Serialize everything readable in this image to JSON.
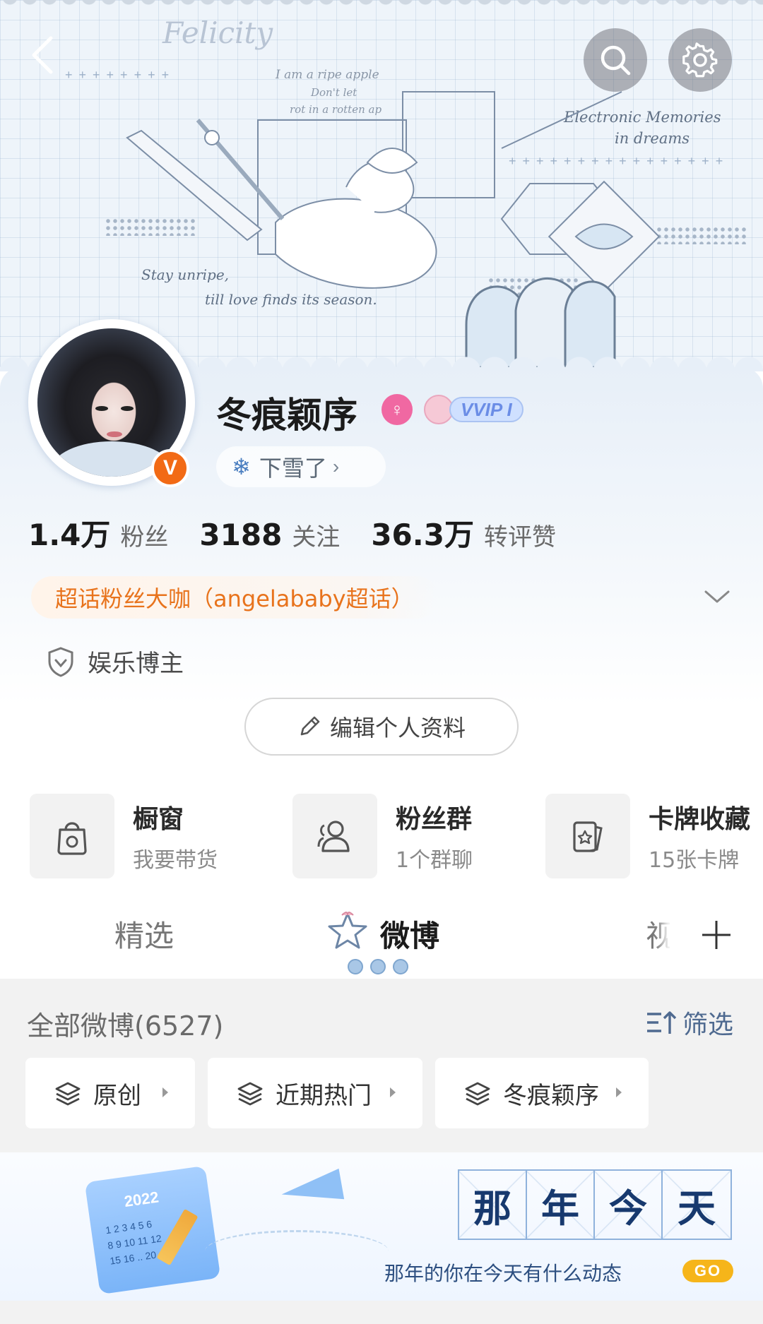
{
  "header": {
    "decor_texts": {
      "felicity": "Felicity",
      "line1": "I am a ripe apple",
      "line2": "Don't let",
      "line3": "rot in a rotten ap",
      "electronic1": "Electronic Memories",
      "electronic2": "in dreams",
      "stay1": "Stay unripe,",
      "stay2": "till love finds its season."
    }
  },
  "profile": {
    "username": "冬痕颖序",
    "vip_tag": "VVIP I",
    "verified_mark": "V",
    "status": "下雪了",
    "status_icon": "❄",
    "stats": [
      {
        "value": "1.4万",
        "label": "粉丝"
      },
      {
        "value": "3188",
        "label": "关注"
      },
      {
        "value": "36.3万",
        "label": "转评赞"
      }
    ],
    "fan_badge": "超话粉丝大咖（angelababy超话）",
    "role": "娱乐博主",
    "edit_button": "编辑个人资料"
  },
  "entries": [
    {
      "title": "橱窗",
      "sub": "我要带货"
    },
    {
      "title": "粉丝群",
      "sub": "1个群聊"
    },
    {
      "title": "卡牌收藏",
      "sub": "15张卡牌"
    }
  ],
  "tabs": {
    "jingxuan": "精选",
    "weibo": "微博",
    "video": "视"
  },
  "feed": {
    "header": "全部微博(6527)",
    "filter": "筛选",
    "chips": [
      "原创",
      "近期热门",
      "冬痕颖序"
    ],
    "banner": {
      "title_chars": [
        "那",
        "年",
        "今",
        "天"
      ],
      "subtitle": "那年的你在今天有什么动态",
      "go": "GO",
      "calendar_year": "2022",
      "calendar_rows": [
        "1 2 3 4 5 6",
        "8 9 10 11 12",
        "15 16 .. 20"
      ]
    }
  },
  "colors": {
    "accent_orange": "#e8731c",
    "verified_orange": "#f26a15",
    "filter_blue": "#4f6a90",
    "vip_blue": "#6b8de6"
  }
}
